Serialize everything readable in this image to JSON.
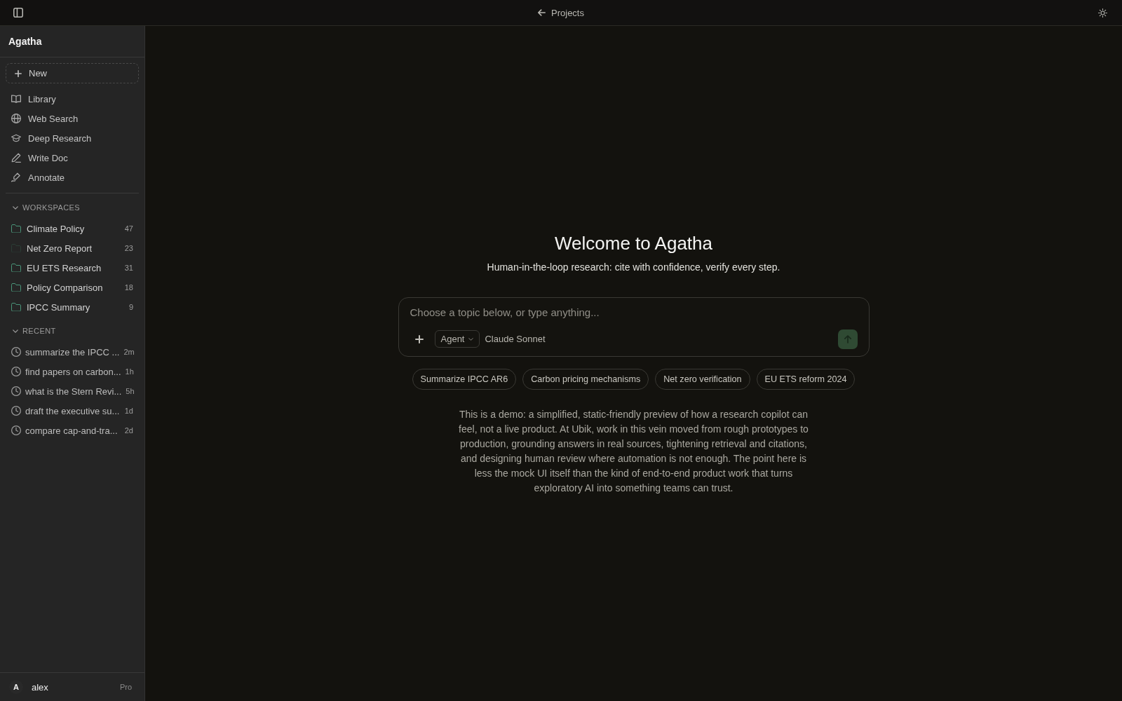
{
  "top_bar": {
    "back_link": "Projects"
  },
  "sidebar": {
    "title": "Agatha",
    "new_button": "New",
    "nav": [
      {
        "label": "Library"
      },
      {
        "label": "Web Search"
      },
      {
        "label": "Deep Research"
      },
      {
        "label": "Write Doc"
      },
      {
        "label": "Annotate"
      }
    ],
    "workspaces": {
      "title": "WORKSPACES",
      "expanded": true,
      "items": [
        {
          "label": "Climate Policy",
          "count": "47",
          "color": "#4a9479"
        },
        {
          "label": "Net Zero Report",
          "count": "23",
          "color": "#2b3d35"
        },
        {
          "label": "EU ETS Research",
          "count": "31",
          "color": "#4a9479"
        },
        {
          "label": "Policy Comparison",
          "count": "18",
          "color": "#4a9479"
        },
        {
          "label": "IPCC Summary",
          "count": "9",
          "color": "#4a9479"
        }
      ]
    },
    "recent": {
      "title": "RECENT",
      "expanded": true,
      "items": [
        {
          "label": "summarize the IPCC ...",
          "time": "2m"
        },
        {
          "label": "find papers on carbon...",
          "time": "1h"
        },
        {
          "label": "what is the Stern Revi...",
          "time": "5h"
        },
        {
          "label": "draft the executive su...",
          "time": "1d"
        },
        {
          "label": "compare cap-and-tra...",
          "time": "2d"
        }
      ]
    },
    "user": {
      "avatar": "A",
      "name": "alex",
      "plan": "Pro"
    }
  },
  "main": {
    "title": "Welcome to Agatha",
    "subtitle": "Human-in-the-loop research: cite with confidence, verify every step.",
    "composer": {
      "placeholder": "Choose a topic below, or type anything...",
      "mode": "Agent",
      "model": "Claude Sonnet"
    },
    "suggestions": [
      "Summarize IPCC AR6",
      "Carbon pricing mechanisms",
      "Net zero verification",
      "EU ETS reform 2024"
    ],
    "note": "This is a demo: a simplified, static-friendly preview of how a research copilot can feel, not a live product. At Ubik, work in this vein moved from rough prototypes to production, grounding answers in real sources, tightening retrieval and citations, and designing human review where automation is not enough. The point here is less the mock UI itself than the kind of end-to-end product work that turns exploratory AI into something teams can trust."
  }
}
